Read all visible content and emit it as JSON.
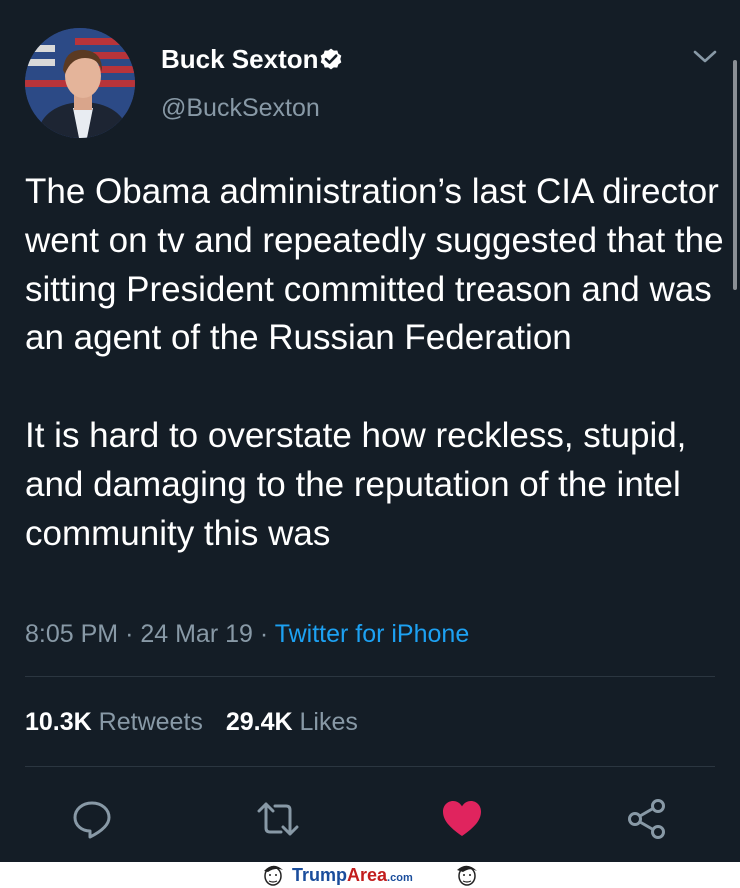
{
  "tweet": {
    "author": {
      "name": "Buck Sexton",
      "handle": "@BuckSexton",
      "verified": true
    },
    "text": "The Obama administration’s last CIA director went on tv and repeatedly suggested that the sitting President committed treason and was an agent of the Russian Federation\n\nIt is hard to overstate how reckless, stupid, and damaging to the reputation of the intel community this was",
    "time": "8:05 PM",
    "date": "24 Mar 19",
    "separator": "·",
    "source": "Twitter for iPhone",
    "retweets_count": "10.3K",
    "retweets_label": "Retweets",
    "likes_count": "29.4K",
    "likes_label": "Likes"
  },
  "actions": [
    {
      "icon": "reply-icon"
    },
    {
      "icon": "retweet-icon"
    },
    {
      "icon": "heart-icon",
      "liked": true
    },
    {
      "icon": "share-icon"
    }
  ],
  "colors": {
    "background": "#141d26",
    "text": "#ffffff",
    "muted": "#8899a6",
    "link": "#1da1f2",
    "like": "#e0245e",
    "divider": "#2b3640"
  },
  "watermark": {
    "brand_a": "Trump",
    "brand_b": "Area",
    "brand_suffix": ".com"
  }
}
